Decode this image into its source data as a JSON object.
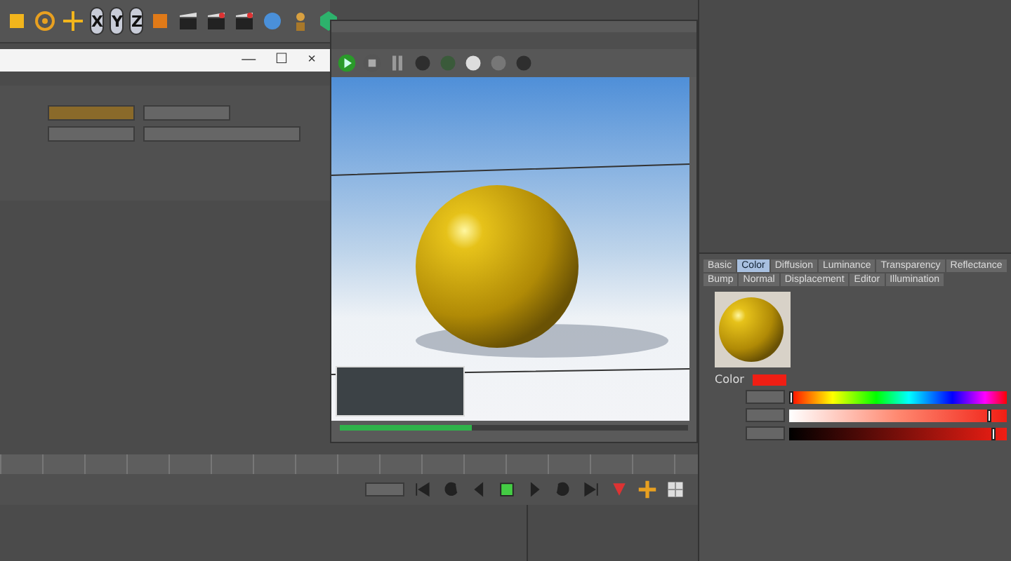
{
  "toolbar": {
    "axis_buttons": [
      {
        "label": "X",
        "selected": true
      },
      {
        "label": "Y",
        "selected": true
      },
      {
        "label": "Z",
        "selected": true
      }
    ]
  },
  "dialog": {
    "controls": [
      "—",
      "☐",
      "×"
    ]
  },
  "picture_viewer": {
    "progress": {
      "level": 0.38
    }
  },
  "material_editor": {
    "tabs": [
      {
        "label": "Basic",
        "selected": false
      },
      {
        "label": "Color",
        "selected": true
      },
      {
        "label": "Diffusion",
        "selected": false
      },
      {
        "label": "Luminance",
        "selected": false
      },
      {
        "label": "Transparency",
        "selected": false
      },
      {
        "label": "Reflectance",
        "selected": false
      },
      {
        "label": "Bump",
        "selected": false
      },
      {
        "label": "Normal",
        "selected": false
      },
      {
        "label": "Displacement",
        "selected": false
      },
      {
        "label": "Editor",
        "selected": false
      },
      {
        "label": "Illumination",
        "selected": false
      }
    ],
    "color": {
      "label": "Color",
      "swatch": {
        "color": "#f01e14"
      },
      "sliders": [
        {
          "kind": "hue",
          "level": 0.01
        },
        {
          "kind": "saturation",
          "level": 0.92
        },
        {
          "kind": "value",
          "level": 0.94
        }
      ]
    }
  }
}
